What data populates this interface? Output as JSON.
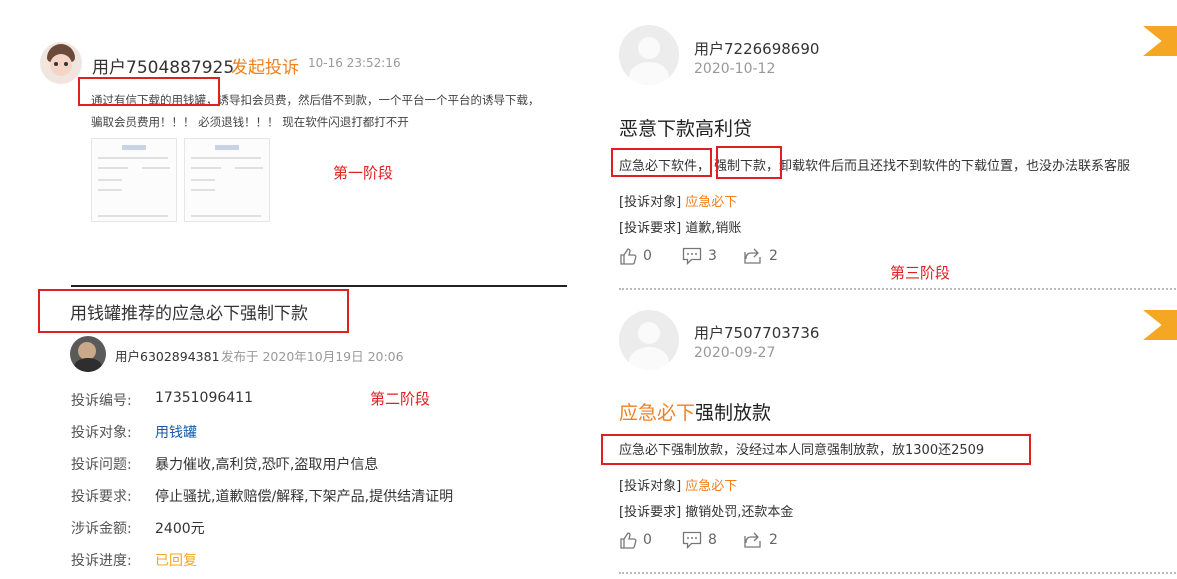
{
  "left_top": {
    "user": "用户7504887925",
    "action": "发起投诉",
    "time": "10-16 23:52:16",
    "text_line1_boxed": "通过有信下载的用钱罐",
    "text_line1_rest": "，诱导扣会员费，然后借不到款，一个平台一个平台的诱导下载，",
    "text_line2": "骗取会员费用！！！ 必须退钱！！！ 现在软件闪退打都打不开",
    "stage_label": "第一阶段"
  },
  "left_bottom": {
    "title": "用钱罐推荐的应急必下强制下款",
    "user": "用户6302894381",
    "published": "发布于 2020年10月19日 20:06",
    "stage_label": "第二阶段",
    "fields": [
      {
        "label": "投诉编号:",
        "value": "17351096411"
      },
      {
        "label": "投诉对象:",
        "value": "用钱罐"
      },
      {
        "label": "投诉问题:",
        "value": "暴力催收,高利贷,恐吓,盗取用户信息"
      },
      {
        "label": "投诉要求:",
        "value": "停止骚扰,道歉赔偿/解释,下架产品,提供结清证明"
      },
      {
        "label": "涉诉金额:",
        "value": "2400元"
      },
      {
        "label": "投诉进度:",
        "value": "已回复"
      }
    ]
  },
  "right_top": {
    "user": "用户7226698690",
    "date": "2020-10-12",
    "title": "恶意下款高利贷",
    "box1": "应急必下软件，",
    "box2": "强制下款，",
    "text_rest": "卸载软件后而且还找不到软件的下载位置，也没办法联系客服",
    "target_label": "[投诉对象]",
    "target_value": "应急必下",
    "demand_label": "[投诉要求]",
    "demand_value": "道歉,销账",
    "likes": "0",
    "comments": "3",
    "shares": "2",
    "stage_label": "第三阶段"
  },
  "right_bottom": {
    "user": "用户7507703736",
    "date": "2020-09-27",
    "title_orange": "应急必下",
    "title_rest": "强制放款",
    "boxed_text": "应急必下强制放款，没经过本人同意强制放款，放1300还2509",
    "target_label": "[投诉对象]",
    "target_value": "应急必下",
    "demand_label": "[投诉要求]",
    "demand_value": "撤销处罚,还款本金",
    "likes": "0",
    "comments": "8",
    "shares": "2"
  },
  "colors": {
    "accent_orange": "#f08020",
    "annotation_red": "#e02020",
    "flag": "#f5a623",
    "link_blue": "#1a5aa6"
  },
  "icons": [
    "avatar-icon",
    "thumbs-up-icon",
    "comment-icon",
    "share-icon",
    "flag-icon"
  ]
}
